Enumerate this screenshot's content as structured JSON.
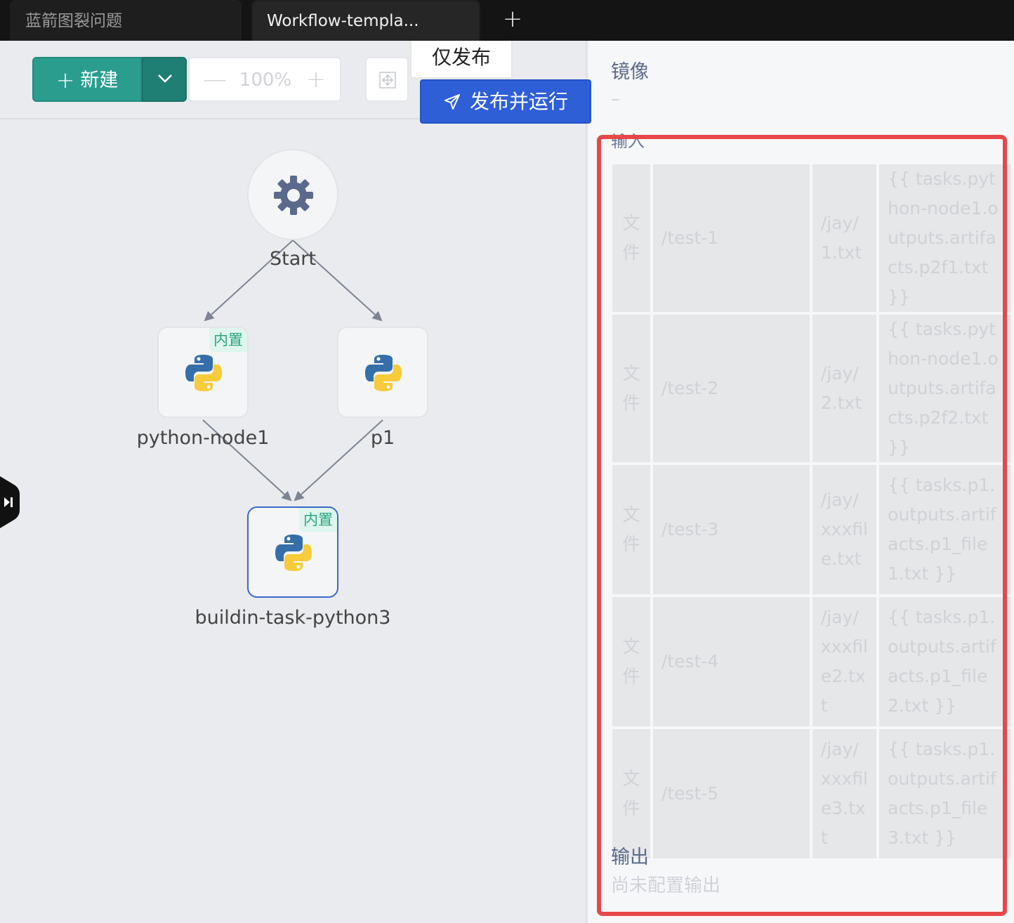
{
  "tabs": [
    {
      "label": "蓝箭图裂问题",
      "active": false
    },
    {
      "label": "Workflow-templa...",
      "active": true
    }
  ],
  "tab_add_label": "+",
  "toolbar": {
    "new_label": "新建",
    "zoom_value": "100%",
    "zoom_minus": "—",
    "zoom_plus": "+",
    "publish_only_label": "仅发布",
    "publish_run_label": "发布并运行"
  },
  "graph": {
    "start_label": "Start",
    "nodes": [
      {
        "label": "python-node1",
        "badge": "内置",
        "icon": "python-icon"
      },
      {
        "label": "p1",
        "badge": "",
        "icon": "python-icon"
      },
      {
        "label": "buildin-task-python3",
        "badge": "内置",
        "icon": "python-icon",
        "selected": true
      }
    ]
  },
  "panel": {
    "mirror_label": "镜像",
    "mirror_value": "–",
    "input_label": "输入",
    "inputs": [
      {
        "type": "文件",
        "name": "/test-1",
        "path": "/jay/1.txt",
        "source": "{{ tasks.python-node1.outputs.artifacts.p2f1.txt }}"
      },
      {
        "type": "文件",
        "name": "/test-2",
        "path": "/jay/2.txt",
        "source": "{{ tasks.python-node1.outputs.artifacts.p2f2.txt }}"
      },
      {
        "type": "文件",
        "name": "/test-3",
        "path": "/jay/xxxfile.txt",
        "source": "{{ tasks.p1.outputs.artifacts.p1_file1.txt }}"
      },
      {
        "type": "文件",
        "name": "/test-4",
        "path": "/jay/xxxfile2.txt",
        "source": "{{ tasks.p1.outputs.artifacts.p1_file2.txt }}"
      },
      {
        "type": "文件",
        "name": "/test-5",
        "path": "/jay/xxxfile3.txt",
        "source": "{{ tasks.p1.outputs.artifacts.p1_file3.txt }}"
      }
    ],
    "output_label": "输出",
    "output_value": "尚未配置输出"
  },
  "colors": {
    "primary_green": "#2a9d8f",
    "primary_blue": "#2e5fd6",
    "highlight_red": "#e84749",
    "badge_green": "#2aa580"
  }
}
